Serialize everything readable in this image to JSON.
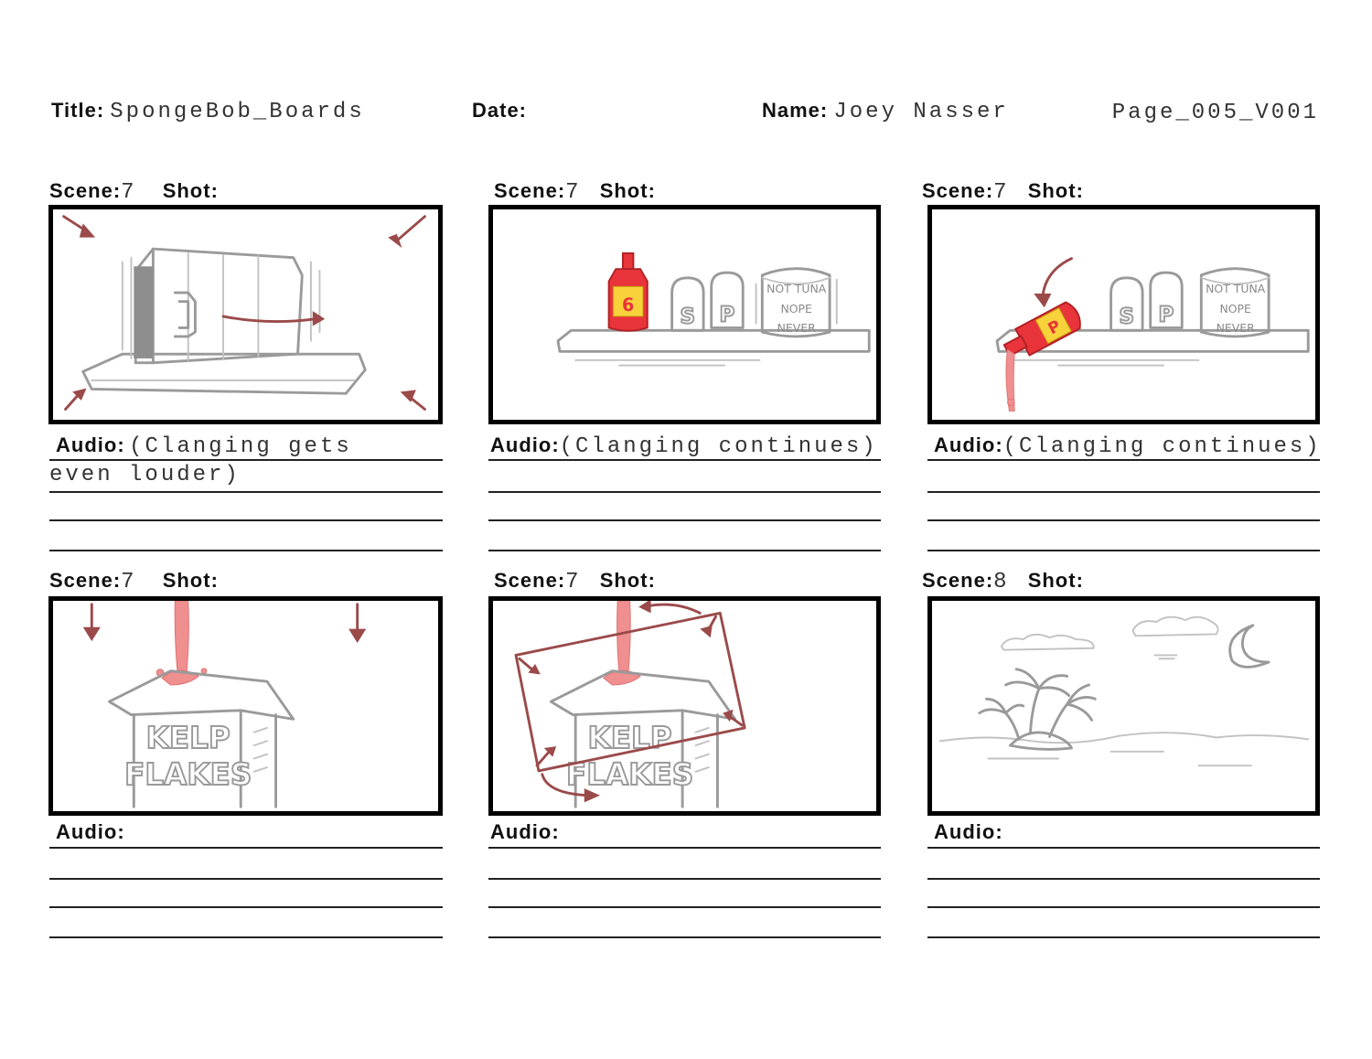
{
  "header": {
    "title_label": "Title:",
    "title_value": "SpongeBob_Boards",
    "date_label": "Date:",
    "date_value": "",
    "name_label": "Name:",
    "name_value": "Joey Nasser",
    "page_id": "Page_005_V001"
  },
  "labels": {
    "scene": "Scene:",
    "shot": "Shot:",
    "audio": "Audio:"
  },
  "panels": [
    {
      "scene": "7",
      "shot": "",
      "audio_line1": "(Clanging gets",
      "audio_line2": "even louder)"
    },
    {
      "scene": "7",
      "shot": "",
      "audio_line1": "(Clanging continues)",
      "audio_line2": ""
    },
    {
      "scene": "7",
      "shot": "",
      "audio_line1": "(Clanging continues)",
      "audio_line2": ""
    },
    {
      "scene": "7",
      "shot": "",
      "audio_line1": "",
      "audio_line2": ""
    },
    {
      "scene": "7",
      "shot": "",
      "audio_line1": "",
      "audio_line2": ""
    },
    {
      "scene": "8",
      "shot": "",
      "audio_line1": "",
      "audio_line2": ""
    }
  ],
  "art": {
    "can_lines": [
      "NOT TUNA",
      "NOPE",
      "NEVER"
    ],
    "shaker_letters": [
      "S",
      "P"
    ],
    "box_lines": [
      "KELP",
      "FLAKES"
    ],
    "bottle_mark": "6",
    "bottle_mark_tipped": "P"
  },
  "colors": {
    "arrow_red": "#9b4a4a",
    "sketch_gray": "#9a9a9a",
    "sauce_pink": "#ef8f8f",
    "bottle_red": "#e8343a",
    "label_yellow": "#f7d23a"
  }
}
